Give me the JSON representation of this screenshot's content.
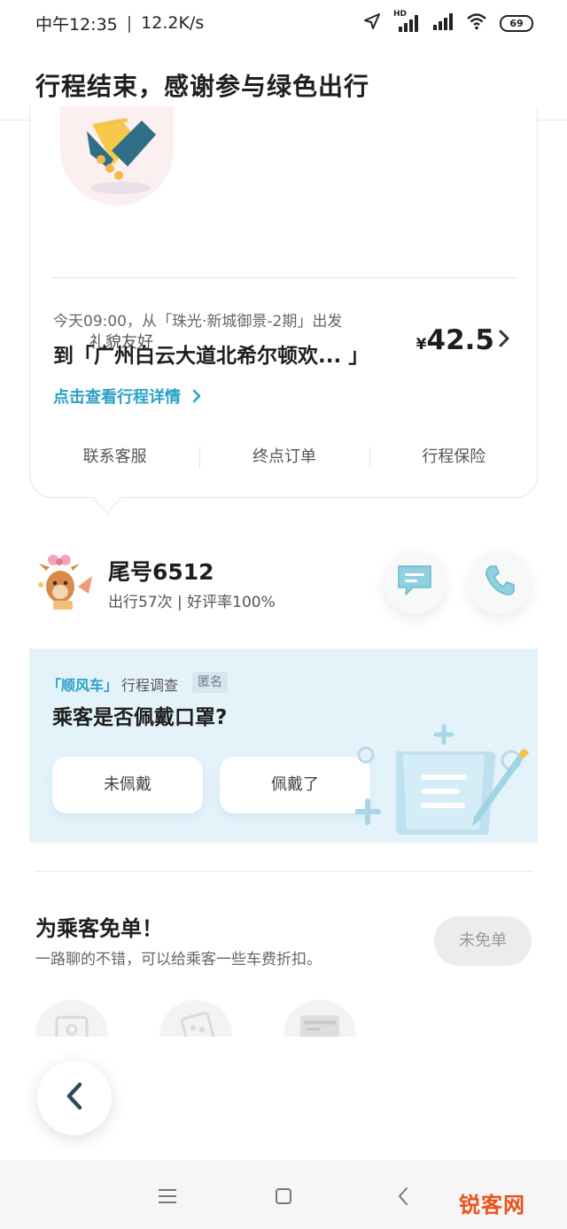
{
  "status_bar": {
    "time": "中午12:35",
    "separator": "|",
    "network_speed": "12.2K/s",
    "hd_label": "HD",
    "battery": "69"
  },
  "header": {
    "title": "行程结束，感谢参与绿色出行"
  },
  "trip_card": {
    "badge_label": "礼貌友好",
    "from_text": "今天09:00，从「珠光·新城御景-2期」出发",
    "to_text": "到「广州白云大道北希尔顿欢...  」",
    "price_symbol": "¥",
    "price": "42.5",
    "detail_link": "点击查看行程详情",
    "actions": [
      {
        "label": "联系客服"
      },
      {
        "label": "终点订单"
      },
      {
        "label": "行程保险"
      }
    ]
  },
  "driver": {
    "tail_number": "尾号6512",
    "stats": "出行57次 | 好评率100%"
  },
  "survey": {
    "brand": "「顺风车」",
    "type": "行程调查",
    "anonymous": "匿名",
    "question": "乘客是否佩戴口罩?",
    "options": [
      {
        "label": "未佩戴"
      },
      {
        "label": "佩戴了"
      }
    ]
  },
  "free_ride": {
    "title": "为乘客免单！",
    "description": "一路聊的不错，可以给乘客一些车费折扣。",
    "button": "未免单"
  },
  "watermark": "锐客网",
  "colors": {
    "accent": "#2aa0c8",
    "survey_bg": "#e4f2fa",
    "watermark": "#e8531e"
  }
}
